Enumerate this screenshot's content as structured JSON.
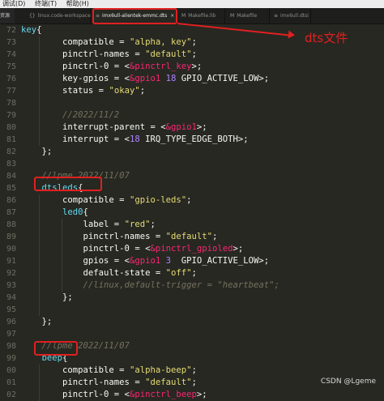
{
  "menu": [
    "调试(D)",
    "终端(T)",
    "帮助(H)"
  ],
  "sidebar_cut": "资源",
  "tabs": [
    {
      "label": "linux.code-workspace",
      "icon": "{}"
    },
    {
      "label": "imx6ull-alientek-emmc.dts",
      "icon": "≡",
      "close": "×"
    },
    {
      "label": "Makefile.lib",
      "icon": "M"
    },
    {
      "label": "Makefile",
      "icon": "M"
    },
    {
      "label": "imx6ull.dtsi",
      "icon": "≡"
    }
  ],
  "annotation": "dts文件",
  "watermark": "CSDN @Lgeme",
  "line_numbers": [
    "72",
    "73",
    "74",
    "75",
    "76",
    "77",
    "78",
    "79",
    "80",
    "81",
    "82",
    "83",
    "84",
    "85",
    "86",
    "87",
    "88",
    "89",
    "90",
    "91",
    "92",
    "93",
    "94",
    "95",
    "96",
    "97",
    "98",
    "99",
    "00",
    "01",
    "02"
  ],
  "code": [
    [
      [
        "n",
        "key"
      ],
      [
        "p",
        "{"
      ]
    ],
    [
      [
        "p",
        "        compatible = "
      ],
      [
        "s",
        "\"alpha, key\""
      ],
      [
        "p",
        ";"
      ]
    ],
    [
      [
        "p",
        "        pinctrl-names = "
      ],
      [
        "s",
        "\"default\""
      ],
      [
        "p",
        ";"
      ]
    ],
    [
      [
        "p",
        "        pinctrl-0 = <"
      ],
      [
        "o",
        "&pinctrl_key"
      ],
      [
        "p",
        ">;"
      ]
    ],
    [
      [
        "p",
        "        key-gpios = <"
      ],
      [
        "o",
        "&gpio1"
      ],
      [
        "p",
        " "
      ],
      [
        "m",
        "18"
      ],
      [
        "p",
        " GPIO_ACTIVE_LOW>;"
      ]
    ],
    [
      [
        "p",
        "        status = "
      ],
      [
        "s",
        "\"okay\""
      ],
      [
        "p",
        ";"
      ]
    ],
    [],
    [
      [
        "c",
        "        //2022/11/2"
      ]
    ],
    [
      [
        "p",
        "        interrupt-parent = <"
      ],
      [
        "o",
        "&gpio1"
      ],
      [
        "p",
        ">;"
      ]
    ],
    [
      [
        "p",
        "        interrupt = <"
      ],
      [
        "m",
        "18"
      ],
      [
        "p",
        " IRQ_TYPE_EDGE_BOTH>;"
      ]
    ],
    [
      [
        "p",
        "    };"
      ]
    ],
    [],
    [
      [
        "c",
        "    //lpme 2022/11/07"
      ]
    ],
    [
      [
        "p",
        "    "
      ],
      [
        "n",
        "dtsleds"
      ],
      [
        "p",
        "{"
      ]
    ],
    [
      [
        "p",
        "        compatible = "
      ],
      [
        "s",
        "\"gpio-leds\""
      ],
      [
        "p",
        ";"
      ]
    ],
    [
      [
        "p",
        "        "
      ],
      [
        "n",
        "led0"
      ],
      [
        "p",
        "{"
      ]
    ],
    [
      [
        "p",
        "            label = "
      ],
      [
        "s",
        "\"red\""
      ],
      [
        "p",
        ";"
      ]
    ],
    [
      [
        "p",
        "            pinctrl-names = "
      ],
      [
        "s",
        "\"default\""
      ],
      [
        "p",
        ";"
      ]
    ],
    [
      [
        "p",
        "            pinctrl-0 = <"
      ],
      [
        "o",
        "&pinctrl_gpioled"
      ],
      [
        "p",
        ">;"
      ]
    ],
    [
      [
        "p",
        "            gpios = <"
      ],
      [
        "o",
        "&gpio1"
      ],
      [
        "p",
        " "
      ],
      [
        "m",
        "3"
      ],
      [
        "p",
        "  GPIO_ACTIVE_LOW>;"
      ]
    ],
    [
      [
        "p",
        "            default-state = "
      ],
      [
        "s",
        "\"off\""
      ],
      [
        "p",
        ";"
      ]
    ],
    [
      [
        "c",
        "            //linux,default-trigger = \"heartbeat\";"
      ]
    ],
    [
      [
        "p",
        "        };"
      ]
    ],
    [],
    [
      [
        "p",
        "    };"
      ]
    ],
    [],
    [
      [
        "c",
        "    //lpme 2022/11/07"
      ]
    ],
    [
      [
        "p",
        "    "
      ],
      [
        "n",
        "beep"
      ],
      [
        "p",
        "{"
      ]
    ],
    [
      [
        "p",
        "        compatible = "
      ],
      [
        "s",
        "\"alpha-beep\""
      ],
      [
        "p",
        ";"
      ]
    ],
    [
      [
        "p",
        "        pinctrl-names = "
      ],
      [
        "s",
        "\"default\""
      ],
      [
        "p",
        ";"
      ]
    ],
    [
      [
        "p",
        "        pinctrl-0 = <"
      ],
      [
        "o",
        "&pinctrl_beep"
      ],
      [
        "p",
        ">;"
      ]
    ]
  ]
}
